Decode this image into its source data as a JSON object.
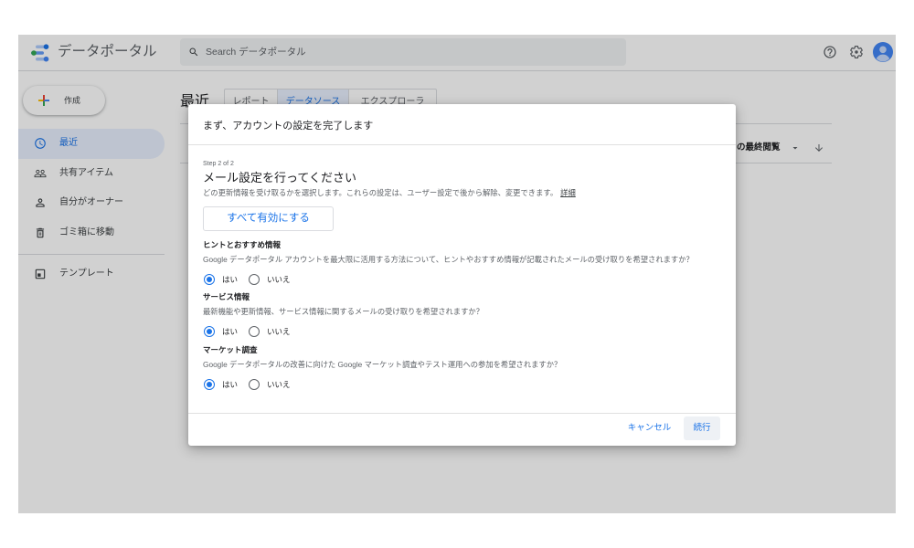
{
  "colors": {
    "accent": "#1a73e8"
  },
  "app": {
    "title": "データポータル",
    "logo_icon": "data-studio-logo-icon"
  },
  "search": {
    "placeholder": "Search データポータル",
    "icon": "search-icon"
  },
  "header": {
    "icons": [
      "help-icon",
      "settings-icon",
      "avatar"
    ]
  },
  "sidebar": {
    "create_label": "作成",
    "create_icon": "plus-icon",
    "items": [
      {
        "label": "最近",
        "icon": "clock-icon",
        "active": true
      },
      {
        "label": "共有アイテム",
        "icon": "people-icon",
        "active": false
      },
      {
        "label": "自分がオーナー",
        "icon": "person-icon",
        "active": false
      },
      {
        "label": "ゴミ箱に移動",
        "icon": "trash-icon",
        "active": false
      }
    ],
    "templates": {
      "label": "テンプレート",
      "icon": "template-icon"
    }
  },
  "main": {
    "title": "最近",
    "tabs": [
      {
        "label": "レポート",
        "active": false
      },
      {
        "label": "データソース",
        "active": true
      },
      {
        "label": "エクスプローラ",
        "active": false
      }
    ],
    "sort": {
      "label": "の最終閲覧",
      "icons": [
        "dropdown-icon",
        "arrow-down-icon"
      ]
    }
  },
  "modal": {
    "title": "まず、アカウントの設定を完了します",
    "step": "Step 2 of 2",
    "heading": "メール設定を行ってください",
    "description": "どの更新情報を受け取るかを選択します。これらの設定は、ユーザー設定で後から解除、変更できます。",
    "details_link": "詳細",
    "enable_all_button": "すべて有効にする",
    "sections": [
      {
        "title": "ヒントとおすすめ情報",
        "description": "Google データポータル アカウントを最大限に活用する方法について、ヒントやおすすめ情報が記載されたメールの受け取りを希望されますか？",
        "options": [
          "はい",
          "いいえ"
        ],
        "selected": "はい"
      },
      {
        "title": "サービス情報",
        "description": "最新機能や更新情報、サービス情報に関するメールの受け取りを希望されますか？",
        "options": [
          "はい",
          "いいえ"
        ],
        "selected": "はい"
      },
      {
        "title": "マーケット調査",
        "description": "Google データポータルの改善に向けた Google マーケット調査やテスト運用への参加を希望されますか？",
        "options": [
          "はい",
          "いいえ"
        ],
        "selected": "はい"
      }
    ],
    "cancel_button": "キャンセル",
    "continue_button": "続行"
  }
}
